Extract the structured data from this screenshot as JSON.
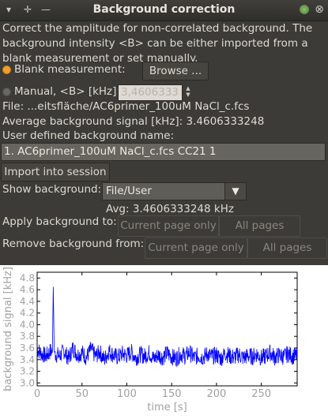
{
  "window": {
    "title": "Background correction",
    "controls": [
      "▾",
      "✛",
      "—"
    ],
    "close_icon": "⊗"
  },
  "description": "Correct the amplitude for non-correlated background. The background intensity <B> can be either imported from a blank measurement or set manually.",
  "blank": {
    "label": "Blank measurement:",
    "selected": true,
    "browse_label": "Browse ..."
  },
  "manual": {
    "label": "Manual, <B> [kHz]:",
    "selected": false,
    "value": "3,4606333"
  },
  "file_label": "File: ...eitsfläche/AC6primer_100uM NaCl_c.fcs",
  "average_label": "Average background signal [kHz]: 3.4606333248",
  "name_label": "User defined background name:",
  "name_value": "1. AC6primer_100uM NaCl_c.fcs CC21 1",
  "import_label": "Import into session",
  "show_background": {
    "label": "Show background:",
    "selected": "File/User",
    "avg_label": "Avg:  3.4606333248 kHz"
  },
  "apply": {
    "label": "Apply background to:",
    "current_page": "Current page only",
    "all_pages": "All pages"
  },
  "remove": {
    "label": "Remove background from:",
    "current_page": "Current page only",
    "all_pages": "All pages"
  },
  "colors": {
    "line": "#0000ff",
    "radio_on": "#f0a030",
    "axis_text": "#a0a0a0"
  },
  "chart_data": {
    "type": "line",
    "xlabel": "time [s]",
    "ylabel": "background signal [kHz]",
    "xlim": [
      0,
      290
    ],
    "ylim": [
      2.95,
      4.9
    ],
    "xticks": [
      0,
      50,
      100,
      150,
      200,
      250
    ],
    "yticks": [
      3.0,
      3.2,
      3.4,
      3.6,
      3.8,
      4.0,
      4.2,
      4.4,
      4.6,
      4.8
    ],
    "series": [
      {
        "x": [
          0,
          5,
          10,
          15,
          17,
          18,
          19,
          20,
          25,
          30,
          35,
          40,
          45,
          50,
          55,
          60,
          65,
          70,
          75,
          80,
          85,
          90,
          95,
          100,
          105,
          110,
          115,
          120,
          125,
          130,
          135,
          140,
          145,
          150,
          155,
          160,
          165,
          170,
          175,
          180,
          185,
          190,
          195,
          200,
          205,
          210,
          215,
          220,
          225,
          230,
          235,
          240,
          245,
          250,
          255,
          260,
          265,
          270,
          275,
          280,
          285,
          290
        ],
        "values": [
          3.58,
          3.5,
          3.46,
          3.55,
          3.52,
          4.65,
          3.56,
          3.5,
          3.46,
          3.55,
          3.42,
          3.6,
          3.48,
          3.52,
          3.44,
          3.58,
          3.46,
          3.53,
          3.4,
          3.55,
          3.48,
          3.44,
          3.5,
          3.47,
          3.53,
          3.43,
          3.49,
          3.46,
          3.52,
          3.41,
          3.48,
          3.44,
          3.51,
          3.45,
          3.42,
          3.5,
          3.46,
          3.52,
          3.43,
          3.47,
          3.44,
          3.5,
          3.45,
          3.48,
          3.42,
          3.51,
          3.46,
          3.44,
          3.49,
          3.43,
          3.47,
          3.45,
          3.5,
          3.43,
          3.46,
          3.52,
          3.44,
          3.48,
          3.45,
          3.5,
          3.46,
          3.47
        ]
      }
    ],
    "grid": false,
    "legend": "none"
  }
}
